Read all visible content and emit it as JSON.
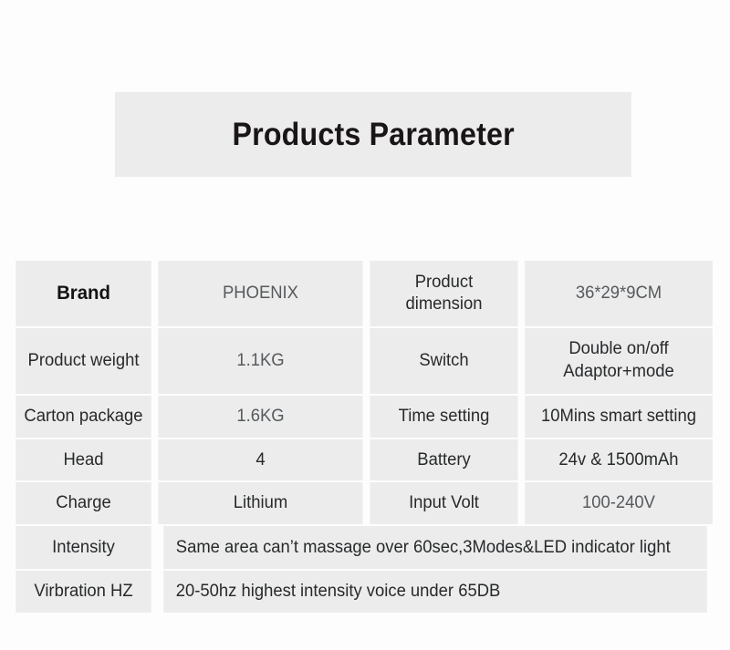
{
  "header": {
    "title": "Products Parameter"
  },
  "table": {
    "rows": [
      {
        "label": "Brand",
        "value": "PHOENIX",
        "label2": "Product dimension",
        "value2": "36*29*9CM"
      },
      {
        "label": "Product weight",
        "value": "1.1KG",
        "label2": "Switch",
        "value2_line1": "Double on/off",
        "value2_line2": "Adaptor+mode"
      },
      {
        "label": "Carton package",
        "value": "1.6KG",
        "label2": "Time setting",
        "value2": "10Mins smart setting"
      },
      {
        "label": "Head",
        "value": "4",
        "label2": "Battery",
        "value2": "24v & 1500mAh"
      },
      {
        "label": "Charge",
        "value": "Lithium",
        "label2": "Input Volt",
        "value2": "100-240V"
      },
      {
        "label": "Intensity",
        "value_span": "Same area can’t massage over 60sec,3Modes&LED indicator light"
      },
      {
        "label": "Virbration HZ",
        "value_span": "20-50hz highest intensity voice under 65DB"
      }
    ]
  },
  "colors": {
    "page_background": "#fdfdfd",
    "cell_background": "#ececec",
    "text": "#27292b",
    "title_text": "#1a1618"
  }
}
